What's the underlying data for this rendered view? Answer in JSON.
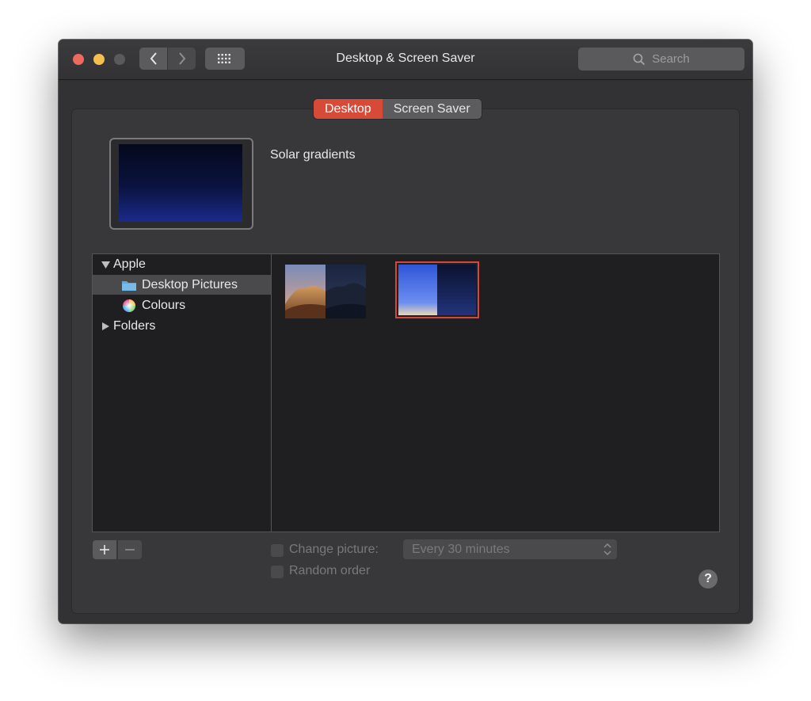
{
  "window": {
    "title": "Desktop & Screen Saver"
  },
  "search": {
    "placeholder": "Search"
  },
  "tabs": [
    {
      "label": "Desktop",
      "active": true
    },
    {
      "label": "Screen Saver",
      "active": false
    }
  ],
  "current": {
    "name": "Solar gradients"
  },
  "sources": {
    "apple": "Apple",
    "desktop_pictures": "Desktop Pictures",
    "colours": "Colours",
    "folders": "Folders"
  },
  "options": {
    "change_picture_label": "Change picture:",
    "interval": "Every 30 minutes",
    "random_order_label": "Random order"
  },
  "help": {
    "label": "?"
  },
  "colors": {
    "accent": "#d84a38",
    "selection_border": "#d8453a"
  },
  "icons": [
    "chevron-left-icon",
    "chevron-right-icon",
    "grid-icon",
    "search-icon",
    "folder-icon",
    "color-wheel-icon",
    "plus-icon",
    "minus-icon",
    "help-icon"
  ]
}
